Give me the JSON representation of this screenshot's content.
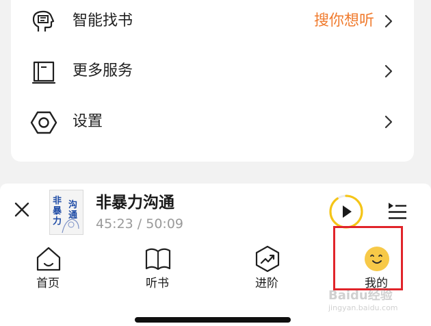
{
  "menu": {
    "items": [
      {
        "label": "智能找书",
        "extra": "搜你想听",
        "icon": "smart-find-book-icon"
      },
      {
        "label": "更多服务",
        "extra": "",
        "icon": "book-service-icon"
      },
      {
        "label": "设置",
        "extra": "",
        "icon": "settings-hexagon-icon"
      }
    ]
  },
  "player": {
    "title": "非暴力沟通",
    "time": "45:23 / 50:09",
    "cover_text_left": "非暴力",
    "cover_text_right": "沟通",
    "progress": 0.905
  },
  "tabs": [
    {
      "label": "首页",
      "icon": "home-icon"
    },
    {
      "label": "听书",
      "icon": "open-book-icon"
    },
    {
      "label": "进阶",
      "icon": "growth-hexagon-icon"
    },
    {
      "label": "我的",
      "icon": "smiley-face-icon"
    }
  ],
  "watermark": {
    "main": "Baidu经验",
    "sub": "jingyan.baidu.com"
  },
  "colors": {
    "accent_orange": "#f07b2e",
    "progress_yellow": "#f5c518",
    "highlight_red": "#e1242a",
    "smiley_yellow": "#f7c948"
  }
}
